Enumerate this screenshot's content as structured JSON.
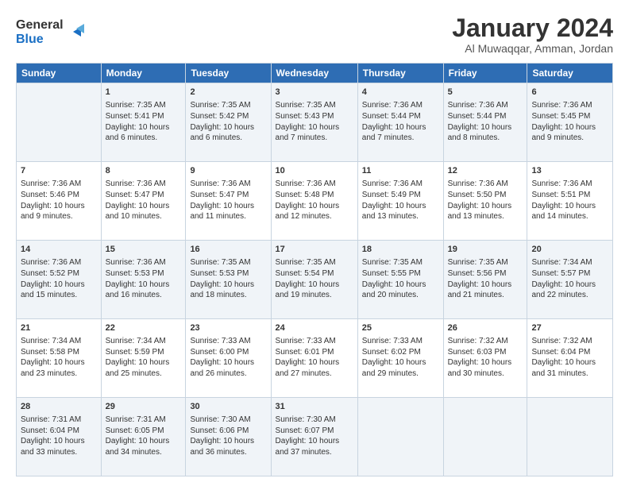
{
  "logo": {
    "line1": "General",
    "line2": "Blue"
  },
  "title": "January 2024",
  "subtitle": "Al Muwaqqar, Amman, Jordan",
  "weekdays": [
    "Sunday",
    "Monday",
    "Tuesday",
    "Wednesday",
    "Thursday",
    "Friday",
    "Saturday"
  ],
  "weeks": [
    [
      {
        "num": "",
        "info": ""
      },
      {
        "num": "1",
        "info": "Sunrise: 7:35 AM\nSunset: 5:41 PM\nDaylight: 10 hours\nand 6 minutes."
      },
      {
        "num": "2",
        "info": "Sunrise: 7:35 AM\nSunset: 5:42 PM\nDaylight: 10 hours\nand 6 minutes."
      },
      {
        "num": "3",
        "info": "Sunrise: 7:35 AM\nSunset: 5:43 PM\nDaylight: 10 hours\nand 7 minutes."
      },
      {
        "num": "4",
        "info": "Sunrise: 7:36 AM\nSunset: 5:44 PM\nDaylight: 10 hours\nand 7 minutes."
      },
      {
        "num": "5",
        "info": "Sunrise: 7:36 AM\nSunset: 5:44 PM\nDaylight: 10 hours\nand 8 minutes."
      },
      {
        "num": "6",
        "info": "Sunrise: 7:36 AM\nSunset: 5:45 PM\nDaylight: 10 hours\nand 9 minutes."
      }
    ],
    [
      {
        "num": "7",
        "info": "Sunrise: 7:36 AM\nSunset: 5:46 PM\nDaylight: 10 hours\nand 9 minutes."
      },
      {
        "num": "8",
        "info": "Sunrise: 7:36 AM\nSunset: 5:47 PM\nDaylight: 10 hours\nand 10 minutes."
      },
      {
        "num": "9",
        "info": "Sunrise: 7:36 AM\nSunset: 5:47 PM\nDaylight: 10 hours\nand 11 minutes."
      },
      {
        "num": "10",
        "info": "Sunrise: 7:36 AM\nSunset: 5:48 PM\nDaylight: 10 hours\nand 12 minutes."
      },
      {
        "num": "11",
        "info": "Sunrise: 7:36 AM\nSunset: 5:49 PM\nDaylight: 10 hours\nand 13 minutes."
      },
      {
        "num": "12",
        "info": "Sunrise: 7:36 AM\nSunset: 5:50 PM\nDaylight: 10 hours\nand 13 minutes."
      },
      {
        "num": "13",
        "info": "Sunrise: 7:36 AM\nSunset: 5:51 PM\nDaylight: 10 hours\nand 14 minutes."
      }
    ],
    [
      {
        "num": "14",
        "info": "Sunrise: 7:36 AM\nSunset: 5:52 PM\nDaylight: 10 hours\nand 15 minutes."
      },
      {
        "num": "15",
        "info": "Sunrise: 7:36 AM\nSunset: 5:53 PM\nDaylight: 10 hours\nand 16 minutes."
      },
      {
        "num": "16",
        "info": "Sunrise: 7:35 AM\nSunset: 5:53 PM\nDaylight: 10 hours\nand 18 minutes."
      },
      {
        "num": "17",
        "info": "Sunrise: 7:35 AM\nSunset: 5:54 PM\nDaylight: 10 hours\nand 19 minutes."
      },
      {
        "num": "18",
        "info": "Sunrise: 7:35 AM\nSunset: 5:55 PM\nDaylight: 10 hours\nand 20 minutes."
      },
      {
        "num": "19",
        "info": "Sunrise: 7:35 AM\nSunset: 5:56 PM\nDaylight: 10 hours\nand 21 minutes."
      },
      {
        "num": "20",
        "info": "Sunrise: 7:34 AM\nSunset: 5:57 PM\nDaylight: 10 hours\nand 22 minutes."
      }
    ],
    [
      {
        "num": "21",
        "info": "Sunrise: 7:34 AM\nSunset: 5:58 PM\nDaylight: 10 hours\nand 23 minutes."
      },
      {
        "num": "22",
        "info": "Sunrise: 7:34 AM\nSunset: 5:59 PM\nDaylight: 10 hours\nand 25 minutes."
      },
      {
        "num": "23",
        "info": "Sunrise: 7:33 AM\nSunset: 6:00 PM\nDaylight: 10 hours\nand 26 minutes."
      },
      {
        "num": "24",
        "info": "Sunrise: 7:33 AM\nSunset: 6:01 PM\nDaylight: 10 hours\nand 27 minutes."
      },
      {
        "num": "25",
        "info": "Sunrise: 7:33 AM\nSunset: 6:02 PM\nDaylight: 10 hours\nand 29 minutes."
      },
      {
        "num": "26",
        "info": "Sunrise: 7:32 AM\nSunset: 6:03 PM\nDaylight: 10 hours\nand 30 minutes."
      },
      {
        "num": "27",
        "info": "Sunrise: 7:32 AM\nSunset: 6:04 PM\nDaylight: 10 hours\nand 31 minutes."
      }
    ],
    [
      {
        "num": "28",
        "info": "Sunrise: 7:31 AM\nSunset: 6:04 PM\nDaylight: 10 hours\nand 33 minutes."
      },
      {
        "num": "29",
        "info": "Sunrise: 7:31 AM\nSunset: 6:05 PM\nDaylight: 10 hours\nand 34 minutes."
      },
      {
        "num": "30",
        "info": "Sunrise: 7:30 AM\nSunset: 6:06 PM\nDaylight: 10 hours\nand 36 minutes."
      },
      {
        "num": "31",
        "info": "Sunrise: 7:30 AM\nSunset: 6:07 PM\nDaylight: 10 hours\nand 37 minutes."
      },
      {
        "num": "",
        "info": ""
      },
      {
        "num": "",
        "info": ""
      },
      {
        "num": "",
        "info": ""
      }
    ]
  ]
}
